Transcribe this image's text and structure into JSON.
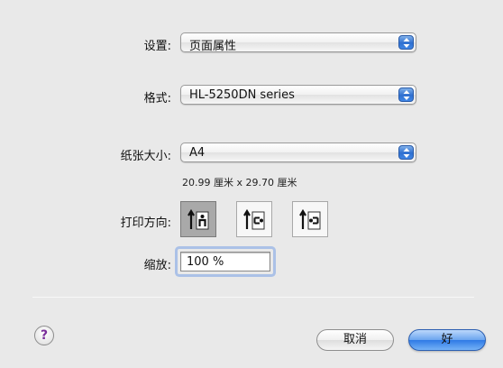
{
  "settings": {
    "label": "设置:",
    "value": "页面属性"
  },
  "format": {
    "label": "格式:",
    "value": "HL-5250DN series"
  },
  "paper_size": {
    "label": "纸张大小:",
    "value": "A4",
    "dimensions": "20.99 厘米 x 29.70 厘米"
  },
  "orientation": {
    "label": "打印方向:",
    "options": [
      {
        "icon": "portrait-icon",
        "selected": true
      },
      {
        "icon": "landscape-left-icon",
        "selected": false
      },
      {
        "icon": "landscape-right-icon",
        "selected": false
      }
    ]
  },
  "scale": {
    "label": "缩放:",
    "value": "100 %"
  },
  "buttons": {
    "help": "?",
    "cancel": "取消",
    "ok": "好"
  },
  "colors": {
    "accent": "#3f86e6",
    "ok_button": "#2f7ae6",
    "help": "#7a2e9a"
  }
}
